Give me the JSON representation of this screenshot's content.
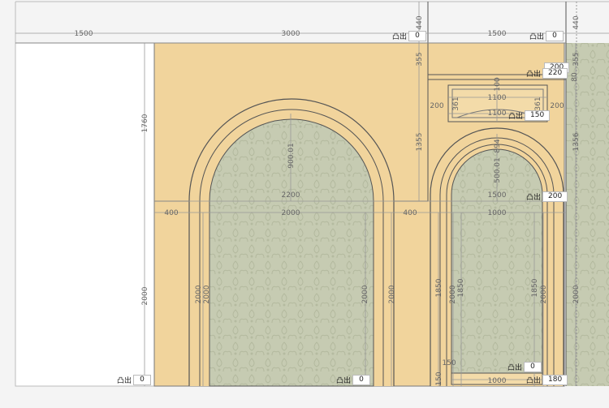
{
  "colors": {
    "wall": "#f1d49c",
    "wallpaper": "#c6cbb2",
    "line": "#555555",
    "dim": "#9a9a9a"
  },
  "top_dims": {
    "d1500a": "1500",
    "d3000": "3000",
    "d1500b": "1500",
    "d440a": "440",
    "d440b": "440"
  },
  "left_dims": {
    "d1760": "1760",
    "d2000": "2000"
  },
  "arch_big": {
    "rise": "900.01",
    "outer": "2200",
    "inner": "2000",
    "left_jamb": "2000",
    "left_jamb2": "2000",
    "right_jamb": "2000",
    "left_pier": "400",
    "right_pier": "400"
  },
  "right_zone": {
    "d355": "355",
    "d1355": "1355",
    "d80": "80",
    "d2000": "2000",
    "panel": {
      "d1100a": "1100",
      "d1100b": "1100",
      "d100": "100",
      "d500": "100",
      "l200": "200",
      "r200": "200",
      "l361": "361",
      "r361": "361"
    },
    "arch": {
      "outer": "1500",
      "inner": "1000",
      "bottom": "1000",
      "rise1": "500.01",
      "rise2": "894",
      "left_a": "1850",
      "left_b": "2000",
      "left_c": "1850",
      "right_a": "1850",
      "right_b": "2000",
      "left_small": "150",
      "bottom_small": "150"
    },
    "far_right": {
      "d355": "355",
      "d1356": "1356",
      "d2000": "2000"
    }
  },
  "tags": [
    {
      "id": "t1",
      "label": "凸出",
      "value": "0"
    },
    {
      "id": "t2",
      "label": "凸出",
      "value": "0"
    },
    {
      "id": "t3",
      "label": "凸出",
      "value": "220"
    },
    {
      "id": "t3b",
      "label": "",
      "value": "200"
    },
    {
      "id": "t4",
      "label": "凸出",
      "value": "150"
    },
    {
      "id": "t5",
      "label": "凸出",
      "value": "200"
    },
    {
      "id": "t6",
      "label": "凸出",
      "value": "0"
    },
    {
      "id": "t7",
      "label": "凸出",
      "value": "0"
    },
    {
      "id": "t8",
      "label": "凸出",
      "value": "0"
    },
    {
      "id": "t9",
      "label": "凸出",
      "value": "180"
    }
  ]
}
